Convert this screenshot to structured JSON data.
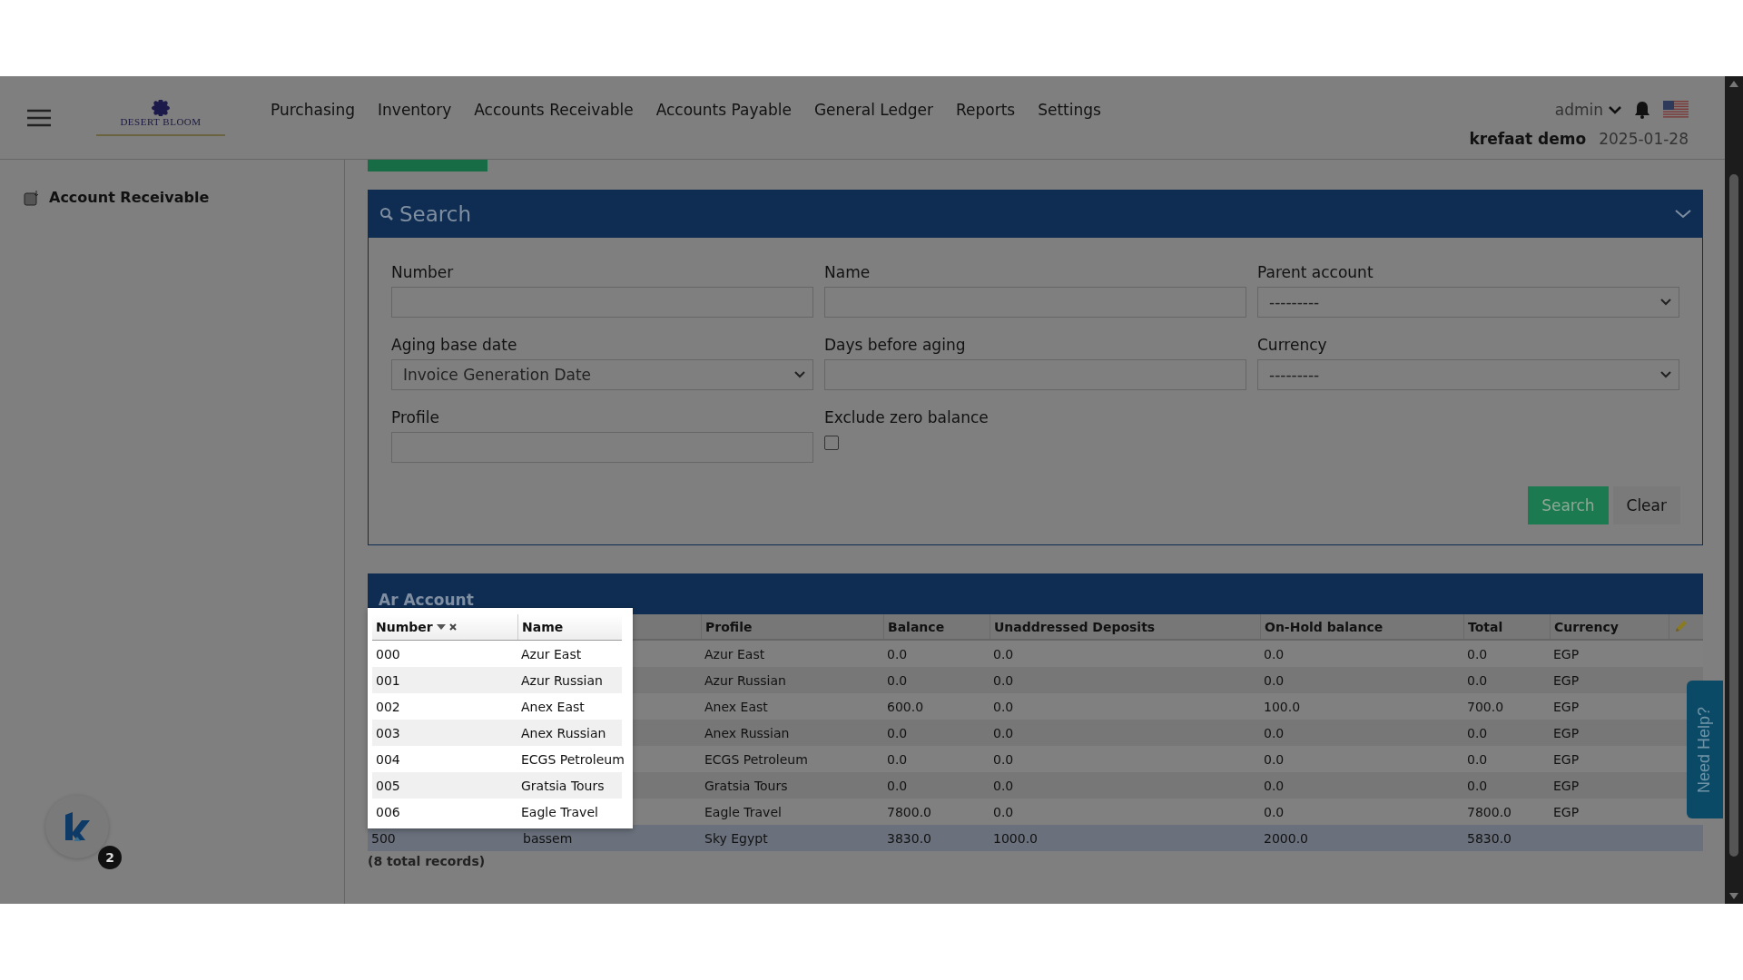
{
  "header": {
    "logo": "DESERT BLOOM",
    "nav": [
      "Purchasing",
      "Inventory",
      "Accounts Receivable",
      "Accounts Payable",
      "General Ledger",
      "Reports",
      "Settings"
    ],
    "user": "admin",
    "company": "krefaat demo",
    "date": "2025-01-28"
  },
  "sidebar": {
    "items": [
      {
        "label": "Account Receivable"
      }
    ]
  },
  "search_panel": {
    "title": "Search",
    "fields": [
      {
        "kind": "text",
        "label": "Number"
      },
      {
        "kind": "text",
        "label": "Name"
      },
      {
        "kind": "select",
        "label": "Parent account",
        "value": "---------"
      },
      {
        "kind": "select",
        "label": "Aging base date",
        "value": "Invoice Generation Date"
      },
      {
        "kind": "text",
        "label": "Days before aging"
      },
      {
        "kind": "select",
        "label": "Currency",
        "value": "---------"
      },
      {
        "kind": "text",
        "label": "Profile"
      },
      {
        "kind": "checkbox",
        "label": "Exclude zero balance",
        "checked": false
      }
    ],
    "buttons": [
      {
        "kind": "primary",
        "label": "Search"
      },
      {
        "kind": "secondary",
        "label": "Clear"
      }
    ]
  },
  "table": {
    "title": "Ar Account",
    "columns": [
      "Profile",
      "Balance",
      "Unaddressed Deposits",
      "On-Hold balance",
      "Total",
      "Currency"
    ],
    "rows": [
      {
        "selected": false,
        "cells": [
          "Azur East",
          "0.0",
          "0.0",
          "0.0",
          "0.0",
          "EGP"
        ]
      },
      {
        "selected": false,
        "cells": [
          "Azur Russian",
          "0.0",
          "0.0",
          "0.0",
          "0.0",
          "EGP"
        ]
      },
      {
        "selected": false,
        "cells": [
          "Anex East",
          "600.0",
          "0.0",
          "100.0",
          "700.0",
          "EGP"
        ]
      },
      {
        "selected": false,
        "cells": [
          "Anex Russian",
          "0.0",
          "0.0",
          "0.0",
          "0.0",
          "EGP"
        ]
      },
      {
        "selected": false,
        "cells": [
          "ECGS Petroleum",
          "0.0",
          "0.0",
          "0.0",
          "0.0",
          "EGP"
        ]
      },
      {
        "selected": false,
        "cells": [
          "Gratsia Tours",
          "0.0",
          "0.0",
          "0.0",
          "0.0",
          "EGP"
        ]
      },
      {
        "selected": false,
        "cells": [
          "Eagle Travel",
          "7800.0",
          "0.0",
          "0.0",
          "7800.0",
          "EGP"
        ]
      },
      {
        "selected": true,
        "number": "500",
        "name": "bassem",
        "cells": [
          "Sky Egypt",
          "3830.0",
          "1000.0",
          "2000.0",
          "5830.0"
        ]
      }
    ],
    "footer": "(8 total records)"
  },
  "column_popup": {
    "columns": [
      "Number",
      "Name"
    ],
    "rows": [
      [
        "000",
        "Azur East"
      ],
      [
        "001",
        "Azur Russian"
      ],
      [
        "002",
        "Anex East"
      ],
      [
        "003",
        "Anex Russian"
      ],
      [
        "004",
        "ECGS Petroleum"
      ],
      [
        "005",
        "Gratsia Tours"
      ],
      [
        "006",
        "Eagle Travel"
      ]
    ]
  },
  "help_tab": "Need Help?",
  "chat_badge": {
    "count": "2"
  }
}
